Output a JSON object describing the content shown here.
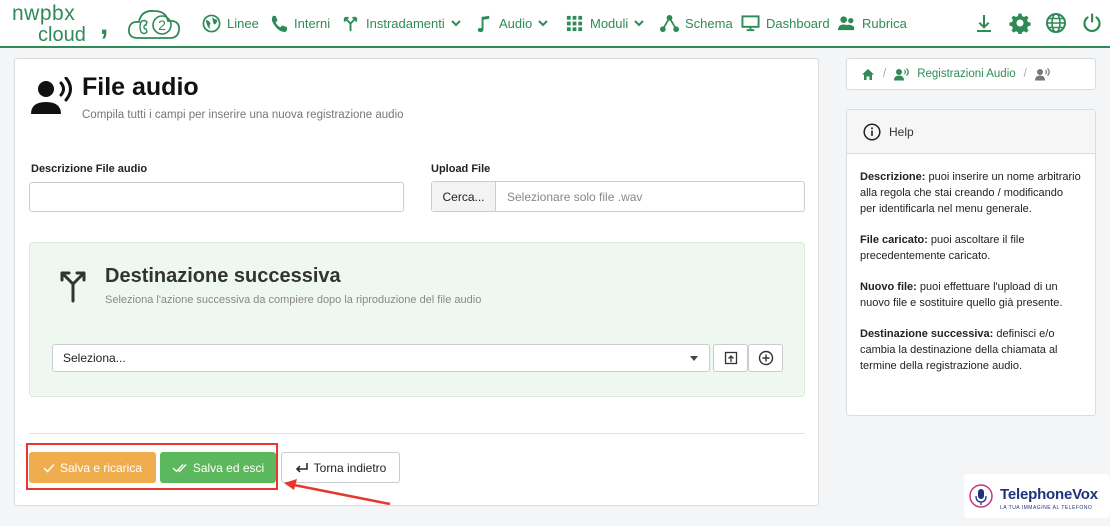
{
  "brand": {
    "logo_line1": "nwpbx",
    "logo_line2": "cloud",
    "badge": "2",
    "accent": "#2e8b57"
  },
  "nav": {
    "items": [
      {
        "label": "Linee",
        "icon": "globe-icon"
      },
      {
        "label": "Interni",
        "icon": "phone-icon"
      },
      {
        "label": "Instradamenti",
        "icon": "route-icon",
        "dropdown": true
      },
      {
        "label": "Audio",
        "icon": "music-note-icon",
        "dropdown": true
      },
      {
        "label": "Moduli",
        "icon": "grid-icon",
        "dropdown": true
      },
      {
        "label": "Schema",
        "icon": "network-icon"
      },
      {
        "label": "Dashboard",
        "icon": "monitor-icon"
      },
      {
        "label": "Rubrica",
        "icon": "contacts-icon"
      }
    ],
    "right_icons": [
      "download-icon",
      "gear-icon",
      "globe-icon",
      "power-icon"
    ]
  },
  "page": {
    "title": "File audio",
    "subtitle": "Compila tutti i campi per inserire una nuova registrazione audio"
  },
  "form": {
    "description_label": "Descrizione File audio",
    "description_value": "",
    "upload_label": "Upload File",
    "upload_button": "Cerca...",
    "upload_placeholder": "Selezionare solo file .wav"
  },
  "destination": {
    "title": "Destinazione successiva",
    "subtitle": "Seleziona l'azione successiva da compiere dopo la riproduzione del file audio",
    "select_value": "Seleziona..."
  },
  "actions": {
    "save_reload": "Salva e ricarica",
    "save_exit": "Salva ed esci",
    "back": "Torna indietro",
    "colors": {
      "warning": "#f0ad4e",
      "success": "#5cb85c",
      "annotation": "#e8382d"
    }
  },
  "breadcrumb": {
    "items": [
      "Registrazioni Audio"
    ]
  },
  "help": {
    "title": "Help",
    "sections": [
      {
        "term": "Descrizione:",
        "text": " puoi inserire un nome arbitrario alla regola che stai creando / modificando per identificarla nel menu generale."
      },
      {
        "term": "File caricato:",
        "text": " puoi ascoltare il file precedentemente caricato."
      },
      {
        "term": "Nuovo file:",
        "text": " puoi effettuare l'upload di un nuovo file e sostituire quello già presente."
      },
      {
        "term": "Destinazione successiva:",
        "text": " definisci e/o cambia la destinazione della chiamata al termine della registrazione audio."
      }
    ]
  },
  "watermark": {
    "text": "TelephoneVox",
    "tagline": "LA TUA IMMAGINE AL TELEFONO"
  }
}
